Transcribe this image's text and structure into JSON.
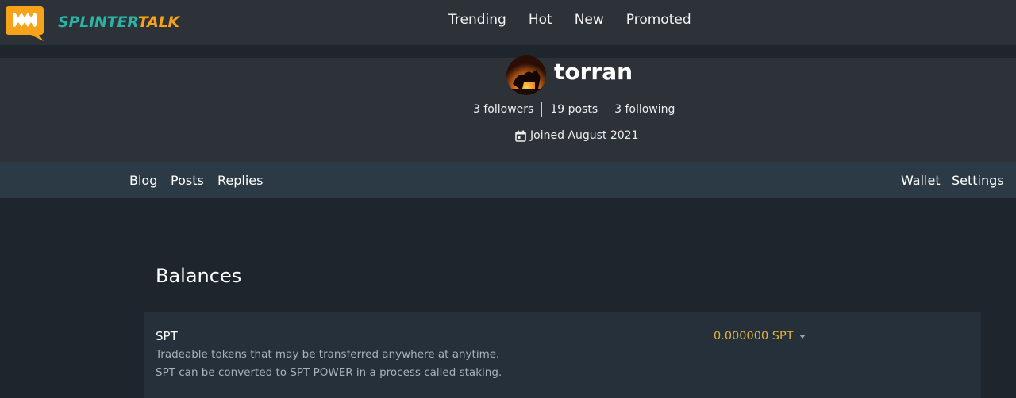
{
  "header": {
    "logo_part1": "SPLINTER",
    "logo_part2": "TALK",
    "nav": [
      "Trending",
      "Hot",
      "New",
      "Promoted"
    ]
  },
  "profile": {
    "username": "torran",
    "followers": "3 followers",
    "posts": "19 posts",
    "following": "3 following",
    "joined": "Joined August 2021"
  },
  "subnav": {
    "left": [
      "Blog",
      "Posts",
      "Replies"
    ],
    "right": [
      "Wallet",
      "Settings"
    ]
  },
  "balances": {
    "title": "Balances",
    "token": {
      "name": "SPT",
      "desc1": "Tradeable tokens that may be transferred anywhere at anytime.",
      "desc2": "SPT can be converted to SPT POWER in a process called staking.",
      "amount": "0.000000 SPT"
    }
  },
  "colors": {
    "logo_teal": "#2ab3a4",
    "logo_orange": "#f7a21b",
    "amount": "#e6b52f"
  }
}
